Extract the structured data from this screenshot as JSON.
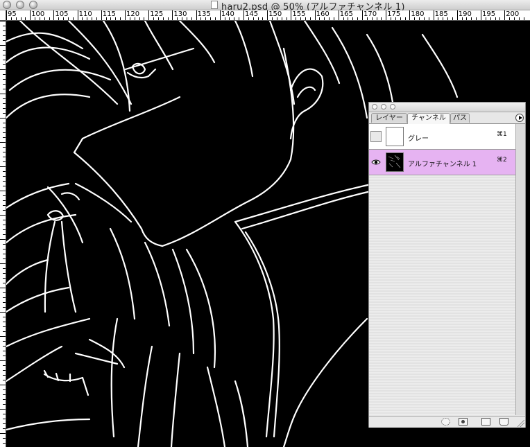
{
  "window": {
    "title": "haru2.psd @ 50% (アルファチャンネル 1)"
  },
  "ruler": {
    "ticks": [
      "95",
      "100",
      "105",
      "110",
      "115",
      "120",
      "125",
      "130",
      "135",
      "140",
      "145",
      "150",
      "155",
      "160",
      "165",
      "170",
      "175",
      "180",
      "185",
      "190",
      "195",
      "200"
    ]
  },
  "palette": {
    "tabs": [
      {
        "label": "レイヤー",
        "active": false
      },
      {
        "label": "チャンネル",
        "active": true
      },
      {
        "label": "パス",
        "active": false
      }
    ],
    "channels": [
      {
        "name": "グレー",
        "shortcut": "⌘1",
        "visible": false,
        "selected": false
      },
      {
        "name": "アルファチャンネル 1",
        "shortcut": "⌘2",
        "visible": true,
        "selected": true
      }
    ]
  },
  "colors": {
    "selected_row": "#e6b3f2",
    "canvas": "#000000",
    "line_art": "#ffffff"
  }
}
